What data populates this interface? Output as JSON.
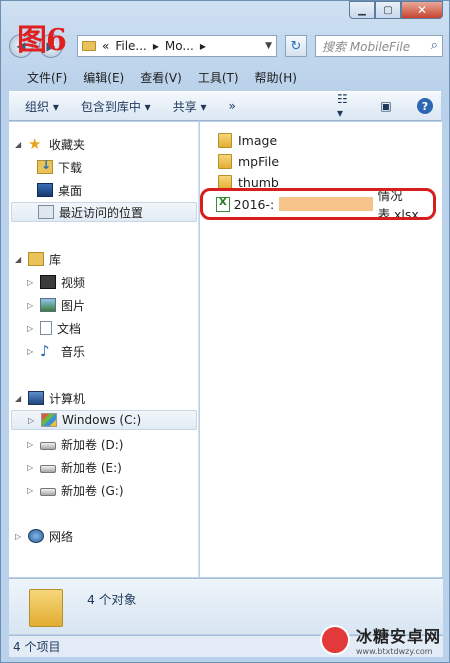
{
  "figure_label": "图6",
  "address": {
    "segments": [
      "«",
      "File...",
      "▸",
      "Mo...",
      "▸"
    ]
  },
  "search": {
    "placeholder": "搜索 MobileFile"
  },
  "menu": [
    "文件(F)",
    "编辑(E)",
    "查看(V)",
    "工具(T)",
    "帮助(H)"
  ],
  "commands": {
    "organize": "组织 ▾",
    "include_library": "包含到库中 ▾",
    "share": "共享 ▾",
    "more": "»"
  },
  "nav": {
    "favorites": {
      "label": "收藏夹",
      "items": [
        "下载",
        "桌面",
        "最近访问的位置"
      ]
    },
    "library": {
      "label": "库",
      "items": [
        "视频",
        "图片",
        "文档",
        "音乐"
      ]
    },
    "computer": {
      "label": "计算机",
      "items": [
        "Windows (C:)",
        "新加卷 (D:)",
        "新加卷 (E:)",
        "新加卷 (G:)"
      ]
    },
    "network": {
      "label": "网络"
    }
  },
  "files": [
    {
      "name": "Image",
      "type": "folder"
    },
    {
      "name": "mpFile",
      "type": "folder"
    },
    {
      "name": "thumb",
      "type": "folder"
    },
    {
      "name_prefix": "2016-:",
      "name_suffix": "情况表.xlsx",
      "type": "xlsx"
    }
  ],
  "details": {
    "count": "4 个对象"
  },
  "status": {
    "items": "4 个项目"
  },
  "watermark": {
    "title": "冰糖安卓网",
    "url": "www.btxtdwzy.com"
  }
}
